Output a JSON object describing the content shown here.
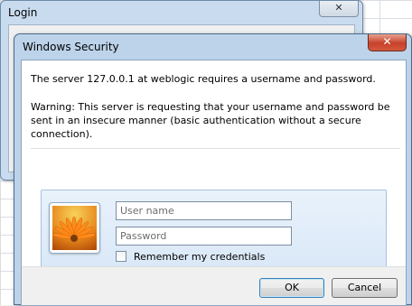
{
  "login_window": {
    "title": "Login",
    "close_glyph": "✕"
  },
  "security_dialog": {
    "title": "Windows Security",
    "close_glyph": "✕",
    "message": "The server 127.0.0.1 at weblogic requires a username and password.",
    "warning": "Warning: This server is requesting that your username and password be sent in an insecure manner (basic authentication without a secure connection).",
    "credentials": {
      "username_placeholder": "User name",
      "password_placeholder": "Password",
      "remember_label": "Remember my credentials",
      "remember_checked": false,
      "avatar_icon": "flower-user-tile-icon"
    },
    "buttons": {
      "ok_label": "OK",
      "cancel_label": "Cancel"
    }
  },
  "colors": {
    "title_bar": "#bcd3ea",
    "close_button": "#c7412a",
    "credential_panel": "#dae8f7"
  }
}
